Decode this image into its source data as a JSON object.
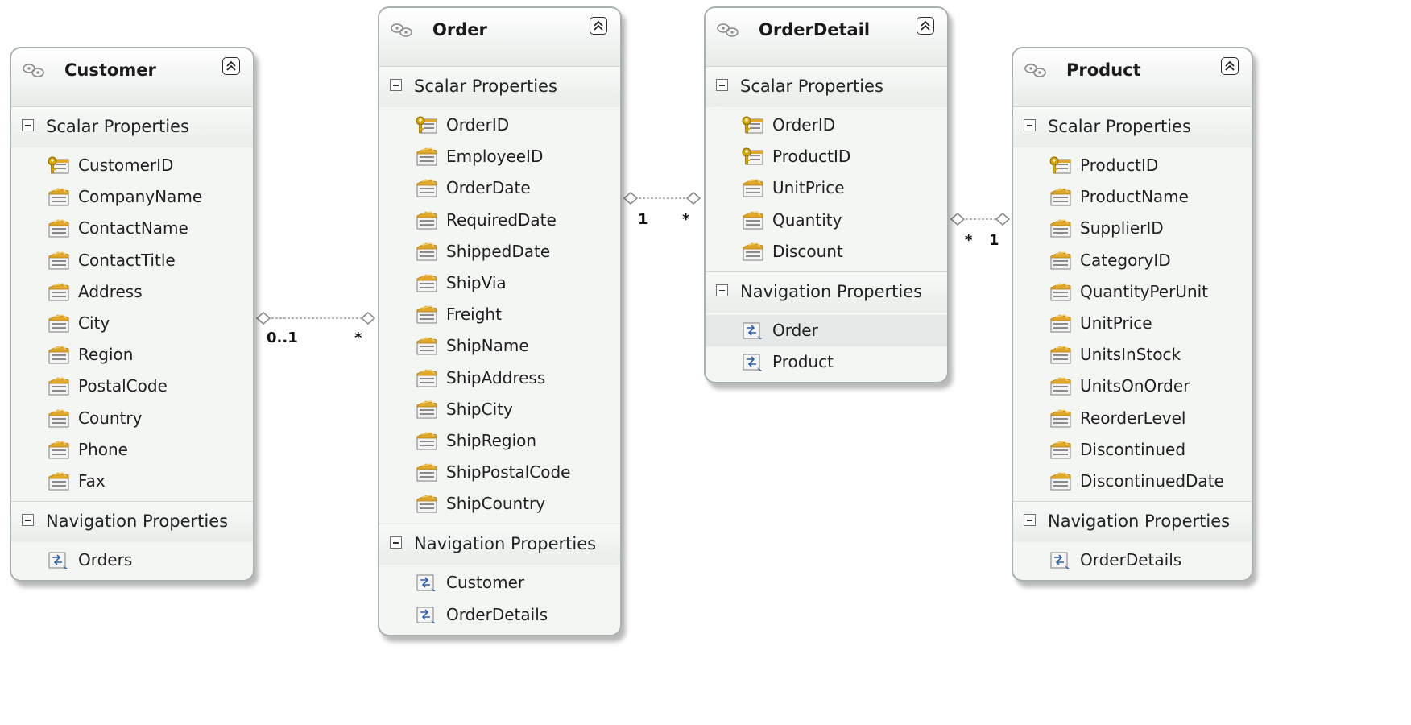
{
  "entities": [
    {
      "name": "Customer",
      "scalar_label": "Scalar Properties",
      "nav_label": "Navigation Properties",
      "scalar": [
        "CustomerID",
        "CompanyName",
        "ContactName",
        "ContactTitle",
        "Address",
        "City",
        "Region",
        "PostalCode",
        "Country",
        "Phone",
        "Fax"
      ],
      "keys": [
        "CustomerID"
      ],
      "navigation": [
        "Orders"
      ]
    },
    {
      "name": "Order",
      "scalar_label": "Scalar Properties",
      "nav_label": "Navigation Properties",
      "scalar": [
        "OrderID",
        "EmployeeID",
        "OrderDate",
        "RequiredDate",
        "ShippedDate",
        "ShipVia",
        "Freight",
        "ShipName",
        "ShipAddress",
        "ShipCity",
        "ShipRegion",
        "ShipPostalCode",
        "ShipCountry"
      ],
      "keys": [
        "OrderID"
      ],
      "navigation": [
        "Customer",
        "OrderDetails"
      ]
    },
    {
      "name": "OrderDetail",
      "scalar_label": "Scalar Properties",
      "nav_label": "Navigation Properties",
      "scalar": [
        "OrderID",
        "ProductID",
        "UnitPrice",
        "Quantity",
        "Discount"
      ],
      "keys": [
        "OrderID",
        "ProductID"
      ],
      "navigation": [
        "Order",
        "Product"
      ],
      "selected_navigation": "Order"
    },
    {
      "name": "Product",
      "scalar_label": "Scalar Properties",
      "nav_label": "Navigation Properties",
      "scalar": [
        "ProductID",
        "ProductName",
        "SupplierID",
        "CategoryID",
        "QuantityPerUnit",
        "UnitPrice",
        "UnitsInStock",
        "UnitsOnOrder",
        "ReorderLevel",
        "Discontinued",
        "DiscontinuedDate"
      ],
      "keys": [
        "ProductID"
      ],
      "navigation": [
        "OrderDetails"
      ]
    }
  ],
  "associations": [
    {
      "from": "Customer",
      "to": "Order",
      "from_multiplicity": "0..1",
      "to_multiplicity": "*"
    },
    {
      "from": "Order",
      "to": "OrderDetail",
      "from_multiplicity": "1",
      "to_multiplicity": "*"
    },
    {
      "from": "OrderDetail",
      "to": "Product",
      "from_multiplicity": "*",
      "to_multiplicity": "1"
    }
  ],
  "colors": {
    "entity_fill": "#f3f6f3",
    "entity_border": "#a9b2ad",
    "connector": "#9a9a9a",
    "key_icon": "#d8a400",
    "property_icon": "#e0a82a",
    "nav_icon": "#2b5fb0"
  },
  "icons": {
    "entity": "entity-type-icon",
    "collapse": "collapse-chevron-icon",
    "key": "key-property-icon",
    "property": "scalar-property-icon",
    "navigation": "navigation-property-icon"
  }
}
